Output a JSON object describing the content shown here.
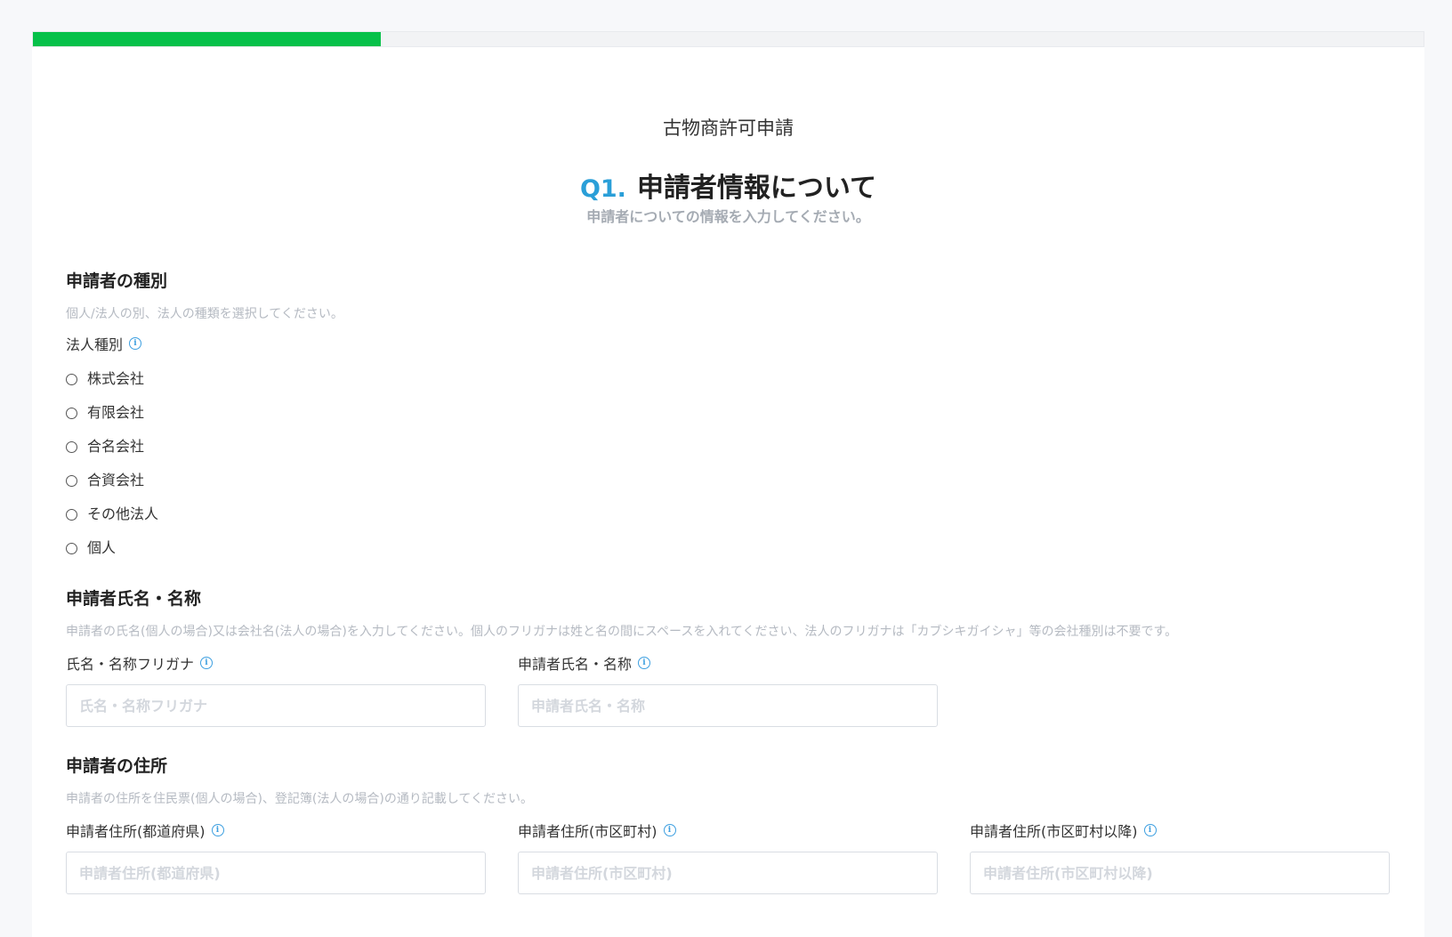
{
  "progress": {
    "fraction": 0.25
  },
  "form": {
    "title": "古物商許可申請"
  },
  "question": {
    "number": "Q1.",
    "title": "申請者情報について",
    "description": "申請者についての情報を入力してください。"
  },
  "applicant_type": {
    "title": "申請者の種別",
    "description": "個人/法人の別、法人の種類を選択してください。",
    "label": "法人種別",
    "options": [
      "株式会社",
      "有限会社",
      "合名会社",
      "合資会社",
      "その他法人",
      "個人"
    ]
  },
  "applicant_name": {
    "title": "申請者氏名・名称",
    "description": "申請者の氏名(個人の場合)又は会社名(法人の場合)を入力してください。個人のフリガナは姓と名の間にスペースを入れてください、法人のフリガナは「カブシキガイシャ」等の会社種別は不要です。",
    "kana": {
      "label": "氏名・名称フリガナ",
      "placeholder": "氏名・名称フリガナ",
      "value": ""
    },
    "name": {
      "label": "申請者氏名・名称",
      "placeholder": "申請者氏名・名称",
      "value": ""
    }
  },
  "applicant_address": {
    "title": "申請者の住所",
    "description": "申請者の住所を住民票(個人の場合)、登記簿(法人の場合)の通り記載してください。",
    "prefecture": {
      "label": "申請者住所(都道府県)",
      "placeholder": "申請者住所(都道府県)",
      "value": ""
    },
    "city": {
      "label": "申請者住所(市区町村)",
      "placeholder": "申請者住所(市区町村)",
      "value": ""
    },
    "rest": {
      "label": "申請者住所(市区町村以降)",
      "placeholder": "申請者住所(市区町村以降)",
      "value": ""
    }
  },
  "colors": {
    "accent": "#06c149",
    "question_number": "#2a9fd8",
    "info_icon": "#3d9fe0"
  },
  "icons": {
    "info": "info-icon",
    "radio": "radio-button"
  }
}
